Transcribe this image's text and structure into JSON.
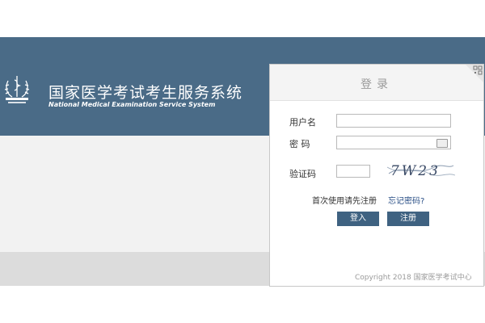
{
  "header": {
    "title": "国家医学考试考生服务系统",
    "subtitle": "National Medical Examination Service System"
  },
  "login": {
    "title": "登录",
    "username_label": "用户名",
    "password_label": "密 码",
    "captcha_label": "验证码",
    "captcha_text": "7W23",
    "first_use_text": "首次使用请先注册",
    "forgot_password_text": "忘记密码?",
    "login_button": "登入",
    "register_button": "注册",
    "copyright": "Copyright 2018 国家医学考试中心"
  },
  "colors": {
    "banner": "#4a6b87",
    "button": "#3f6281",
    "link": "#2a4f86"
  },
  "icons": {
    "emblem": "medical-emblem-icon",
    "qr": "qr-code-icon",
    "keyboard": "keyboard-icon"
  }
}
